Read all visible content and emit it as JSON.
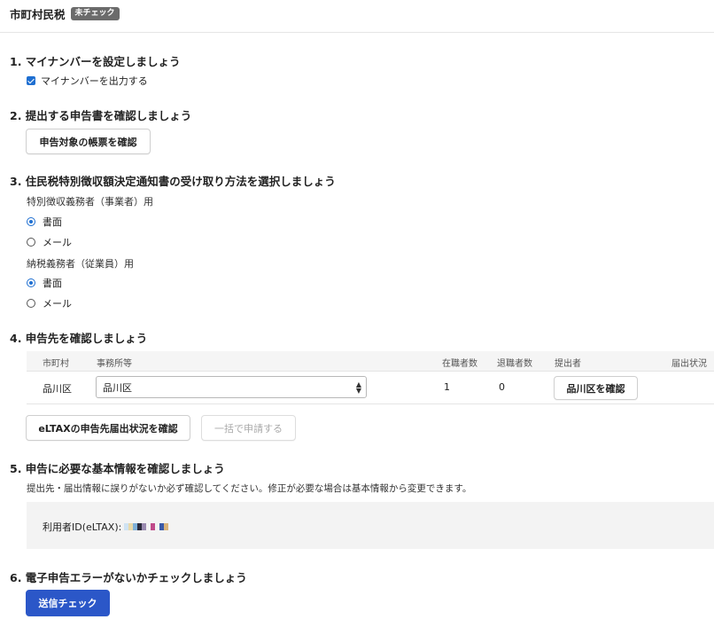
{
  "header": {
    "title": "市町村民税",
    "badge": "未チェック"
  },
  "sections": {
    "s1": {
      "title": "1. マイナンバーを設定しましょう",
      "checkbox_label": "マイナンバーを出力する"
    },
    "s2": {
      "title": "2. 提出する申告書を確認しましょう",
      "button": "申告対象の帳票を確認"
    },
    "s3": {
      "title": "3. 住民税特別徴収額決定通知書の受け取り方法を選択しましょう",
      "group1": {
        "label": "特別徴収義務者（事業者）用",
        "opt1": "書面",
        "opt2": "メール",
        "selected": "書面"
      },
      "group2": {
        "label": "納税義務者（従業員）用",
        "opt1": "書面",
        "opt2": "メール",
        "selected": "書面"
      }
    },
    "s4": {
      "title": "4. 申告先を確認しましょう",
      "columns": [
        "市町村",
        "事務所等",
        "在職者数",
        "退職者数",
        "提出者",
        "届出状況"
      ],
      "row": {
        "municipality": "品川区",
        "office_selected": "品川区",
        "employees": "1",
        "retirees": "0",
        "submitter_button": "品川区を確認",
        "status": ""
      },
      "eltax_button": "eLTAXの申告先届出状況を確認",
      "bulk_button": "一括で申請する"
    },
    "s5": {
      "title": "5. 申告に必要な基本情報を確認しましょう",
      "description": "提出先・届出情報に誤りがないか必ず確認してください。修正が必要な場合は基本情報から変更できます。",
      "user_id_label": "利用者ID(eLTAX):"
    },
    "s6": {
      "title": "6. 電子申告エラーがないかチェックしましょう",
      "button": "送信チェック"
    }
  },
  "colors": {
    "primary": "#2b57c8",
    "checkbox": "#1f6fd1",
    "badge": "#6b6b6b"
  }
}
